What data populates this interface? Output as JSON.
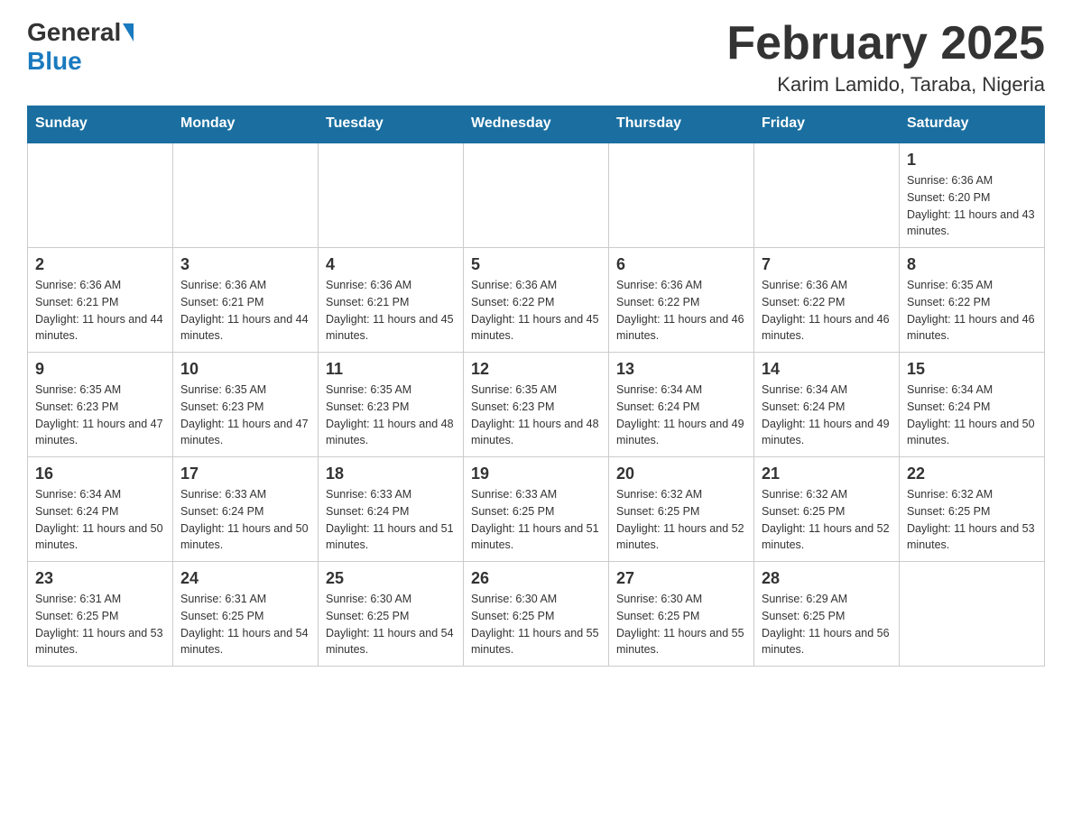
{
  "logo": {
    "general": "General",
    "blue": "Blue"
  },
  "header": {
    "month_title": "February 2025",
    "location": "Karim Lamido, Taraba, Nigeria"
  },
  "weekdays": [
    "Sunday",
    "Monday",
    "Tuesday",
    "Wednesday",
    "Thursday",
    "Friday",
    "Saturday"
  ],
  "weeks": [
    [
      {
        "day": "",
        "info": ""
      },
      {
        "day": "",
        "info": ""
      },
      {
        "day": "",
        "info": ""
      },
      {
        "day": "",
        "info": ""
      },
      {
        "day": "",
        "info": ""
      },
      {
        "day": "",
        "info": ""
      },
      {
        "day": "1",
        "info": "Sunrise: 6:36 AM\nSunset: 6:20 PM\nDaylight: 11 hours and 43 minutes."
      }
    ],
    [
      {
        "day": "2",
        "info": "Sunrise: 6:36 AM\nSunset: 6:21 PM\nDaylight: 11 hours and 44 minutes."
      },
      {
        "day": "3",
        "info": "Sunrise: 6:36 AM\nSunset: 6:21 PM\nDaylight: 11 hours and 44 minutes."
      },
      {
        "day": "4",
        "info": "Sunrise: 6:36 AM\nSunset: 6:21 PM\nDaylight: 11 hours and 45 minutes."
      },
      {
        "day": "5",
        "info": "Sunrise: 6:36 AM\nSunset: 6:22 PM\nDaylight: 11 hours and 45 minutes."
      },
      {
        "day": "6",
        "info": "Sunrise: 6:36 AM\nSunset: 6:22 PM\nDaylight: 11 hours and 46 minutes."
      },
      {
        "day": "7",
        "info": "Sunrise: 6:36 AM\nSunset: 6:22 PM\nDaylight: 11 hours and 46 minutes."
      },
      {
        "day": "8",
        "info": "Sunrise: 6:35 AM\nSunset: 6:22 PM\nDaylight: 11 hours and 46 minutes."
      }
    ],
    [
      {
        "day": "9",
        "info": "Sunrise: 6:35 AM\nSunset: 6:23 PM\nDaylight: 11 hours and 47 minutes."
      },
      {
        "day": "10",
        "info": "Sunrise: 6:35 AM\nSunset: 6:23 PM\nDaylight: 11 hours and 47 minutes."
      },
      {
        "day": "11",
        "info": "Sunrise: 6:35 AM\nSunset: 6:23 PM\nDaylight: 11 hours and 48 minutes."
      },
      {
        "day": "12",
        "info": "Sunrise: 6:35 AM\nSunset: 6:23 PM\nDaylight: 11 hours and 48 minutes."
      },
      {
        "day": "13",
        "info": "Sunrise: 6:34 AM\nSunset: 6:24 PM\nDaylight: 11 hours and 49 minutes."
      },
      {
        "day": "14",
        "info": "Sunrise: 6:34 AM\nSunset: 6:24 PM\nDaylight: 11 hours and 49 minutes."
      },
      {
        "day": "15",
        "info": "Sunrise: 6:34 AM\nSunset: 6:24 PM\nDaylight: 11 hours and 50 minutes."
      }
    ],
    [
      {
        "day": "16",
        "info": "Sunrise: 6:34 AM\nSunset: 6:24 PM\nDaylight: 11 hours and 50 minutes."
      },
      {
        "day": "17",
        "info": "Sunrise: 6:33 AM\nSunset: 6:24 PM\nDaylight: 11 hours and 50 minutes."
      },
      {
        "day": "18",
        "info": "Sunrise: 6:33 AM\nSunset: 6:24 PM\nDaylight: 11 hours and 51 minutes."
      },
      {
        "day": "19",
        "info": "Sunrise: 6:33 AM\nSunset: 6:25 PM\nDaylight: 11 hours and 51 minutes."
      },
      {
        "day": "20",
        "info": "Sunrise: 6:32 AM\nSunset: 6:25 PM\nDaylight: 11 hours and 52 minutes."
      },
      {
        "day": "21",
        "info": "Sunrise: 6:32 AM\nSunset: 6:25 PM\nDaylight: 11 hours and 52 minutes."
      },
      {
        "day": "22",
        "info": "Sunrise: 6:32 AM\nSunset: 6:25 PM\nDaylight: 11 hours and 53 minutes."
      }
    ],
    [
      {
        "day": "23",
        "info": "Sunrise: 6:31 AM\nSunset: 6:25 PM\nDaylight: 11 hours and 53 minutes."
      },
      {
        "day": "24",
        "info": "Sunrise: 6:31 AM\nSunset: 6:25 PM\nDaylight: 11 hours and 54 minutes."
      },
      {
        "day": "25",
        "info": "Sunrise: 6:30 AM\nSunset: 6:25 PM\nDaylight: 11 hours and 54 minutes."
      },
      {
        "day": "26",
        "info": "Sunrise: 6:30 AM\nSunset: 6:25 PM\nDaylight: 11 hours and 55 minutes."
      },
      {
        "day": "27",
        "info": "Sunrise: 6:30 AM\nSunset: 6:25 PM\nDaylight: 11 hours and 55 minutes."
      },
      {
        "day": "28",
        "info": "Sunrise: 6:29 AM\nSunset: 6:25 PM\nDaylight: 11 hours and 56 minutes."
      },
      {
        "day": "",
        "info": ""
      }
    ]
  ]
}
